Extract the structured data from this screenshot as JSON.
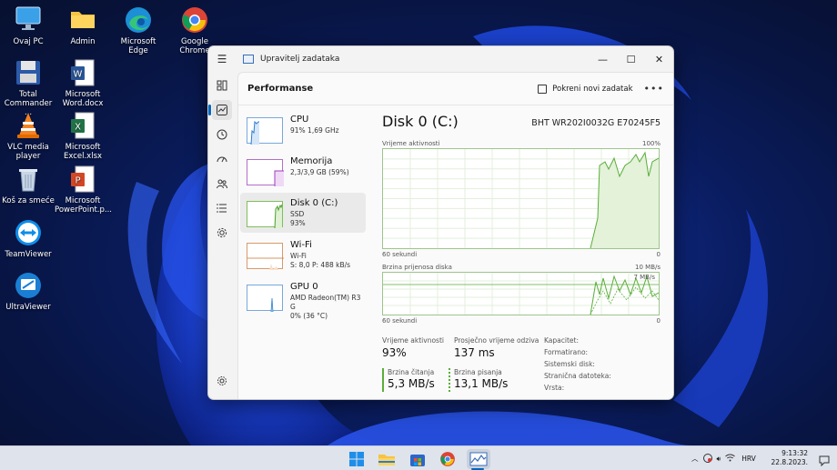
{
  "desktop": {
    "icons": [
      {
        "label": "Ovaj PC"
      },
      {
        "label": "Admin"
      },
      {
        "label": "Microsoft Edge"
      },
      {
        "label": "Google Chrome"
      },
      {
        "label": "Total Commander ..."
      },
      {
        "label": "Microsoft Word.docx"
      },
      {
        "label": "VLC media player"
      },
      {
        "label": "Microsoft Excel.xlsx"
      },
      {
        "label": "Koš za smeće"
      },
      {
        "label": "Microsoft PowerPoint.p..."
      },
      {
        "label": "TeamViewer"
      },
      {
        "label": "UltraViewer"
      }
    ]
  },
  "window": {
    "title": "Upravitelj zadataka",
    "header": {
      "title": "Performanse",
      "new_task_label": "Pokreni novi zadatak"
    }
  },
  "devices": [
    {
      "name": "CPU",
      "line1": "91% 1,69 GHz",
      "line2": ""
    },
    {
      "name": "Memorija",
      "line1": "2,3/3,9 GB (59%)",
      "line2": ""
    },
    {
      "name": "Disk 0 (C:)",
      "line1": "SSD",
      "line2": "93%"
    },
    {
      "name": "Wi-Fi",
      "line1": "Wi-Fi",
      "line2": "S: 8,0 P: 488 kB/s"
    },
    {
      "name": "GPU 0",
      "line1": "AMD Radeon(TM) R3 G",
      "line2": "0% (36 °C)"
    }
  ],
  "detail": {
    "title": "Disk 0 (C:)",
    "model": "BHT WR202I0032G E70245F5",
    "graph1": {
      "label": "Vrijeme aktivnosti",
      "max": "100%",
      "xleft": "60 sekundi",
      "xright": "0"
    },
    "graph2": {
      "label": "Brzina prijenosa diska",
      "max": "10 MB/s",
      "mid": "7 MB/s",
      "xleft": "60 sekundi",
      "xright": "0"
    },
    "stats": {
      "active_label": "Vrijeme aktivnosti",
      "active_value": "93%",
      "resp_label": "Prosječno vrijeme odziva",
      "resp_value": "137 ms",
      "read_label": "Brzina čitanja",
      "read_value": "5,3 MB/s",
      "write_label": "Brzina pisanja",
      "write_value": "13,1 MB/s",
      "props": [
        "Kapacitet:",
        "Formatirano:",
        "Sistemski disk:",
        "Stranična datoteka:",
        "Vrsta:"
      ]
    }
  },
  "taskbar": {
    "language": "HRV",
    "time": "9:13:32",
    "date": "22.8.2023."
  }
}
